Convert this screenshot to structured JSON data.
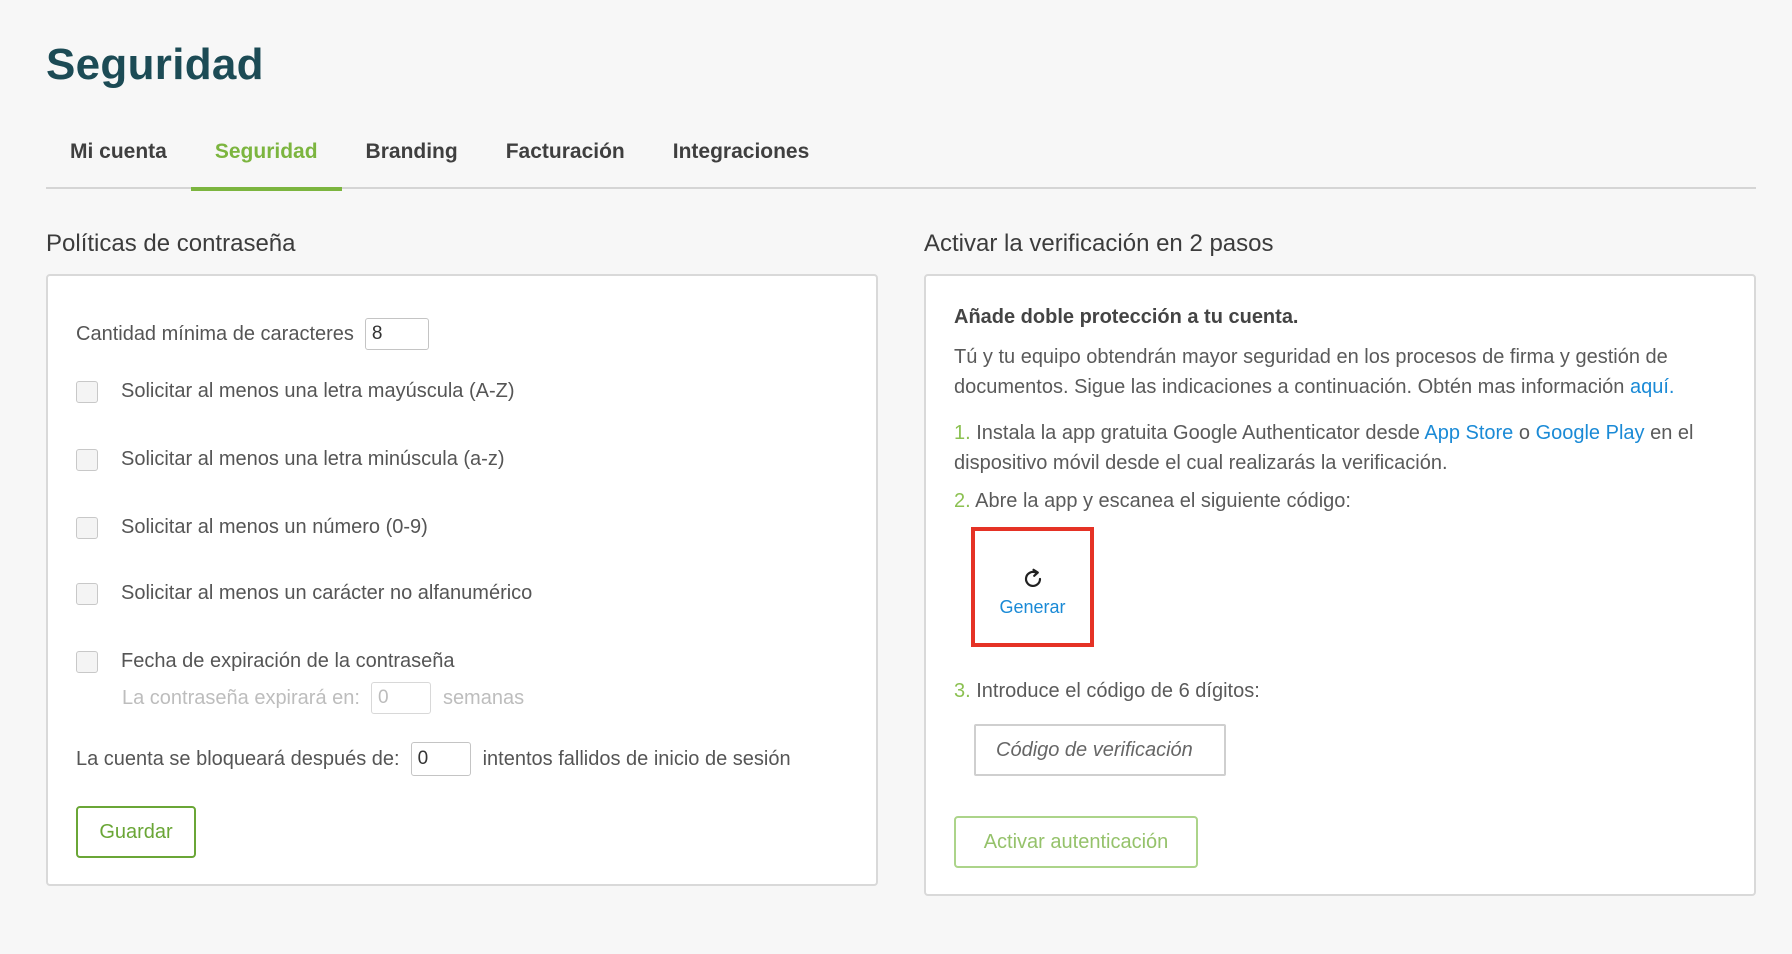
{
  "page": {
    "title": "Seguridad"
  },
  "tabs": [
    {
      "label": "Mi cuenta"
    },
    {
      "label": "Seguridad"
    },
    {
      "label": "Branding"
    },
    {
      "label": "Facturación"
    },
    {
      "label": "Integraciones"
    }
  ],
  "colors": {
    "accent": "#7cb53f",
    "title": "#1c4b55",
    "link": "#1a8ad6",
    "highlight_border": "#e53225"
  },
  "password_policies": {
    "title": "Políticas de contraseña",
    "min_chars_label": "Cantidad mínima de caracteres",
    "min_chars_value": "8",
    "checkboxes": [
      {
        "label": "Solicitar al menos una letra mayúscula (A-Z)",
        "checked": false
      },
      {
        "label": "Solicitar al menos una letra minúscula (a-z)",
        "checked": false
      },
      {
        "label": "Solicitar al menos un número (0-9)",
        "checked": false
      },
      {
        "label": "Solicitar al menos un carácter no alfanumérico",
        "checked": false
      },
      {
        "label": "Fecha de expiración de la contraseña",
        "checked": false
      }
    ],
    "expiry_prefix": "La contraseña expirará en:",
    "expiry_value": "0",
    "expiry_suffix": "semanas",
    "lockout_prefix": "La cuenta se bloqueará después de:",
    "lockout_value": "0",
    "lockout_suffix": "intentos fallidos de inicio de sesión",
    "save_label": "Guardar"
  },
  "two_factor": {
    "title": "Activar la verificación en 2 pasos",
    "heading": "Añade doble protección a tu cuenta.",
    "intro_text": "Tú y tu equipo obtendrán mayor seguridad en los procesos de firma y gestión de documentos. Sigue las indicaciones a continuación. Obtén mas información",
    "intro_link": "aquí.",
    "step1_num": "1.",
    "step1_text_a": "Instala la app gratuita Google Authenticator desde",
    "step1_link_appstore": "App Store",
    "step1_text_or": "o",
    "step1_link_googleplay": "Google Play",
    "step1_text_b": "en el dispositivo móvil desde el cual realizarás la verificación.",
    "step2_num": "2.",
    "step2_text": "Abre la app y escanea el siguiente código:",
    "generate_icon": "refresh-icon",
    "generate_label": "Generar",
    "step3_num": "3.",
    "step3_text": "Introduce el código de 6 dígitos:",
    "code_placeholder": "Código de verificación",
    "activate_label": "Activar autenticación"
  }
}
